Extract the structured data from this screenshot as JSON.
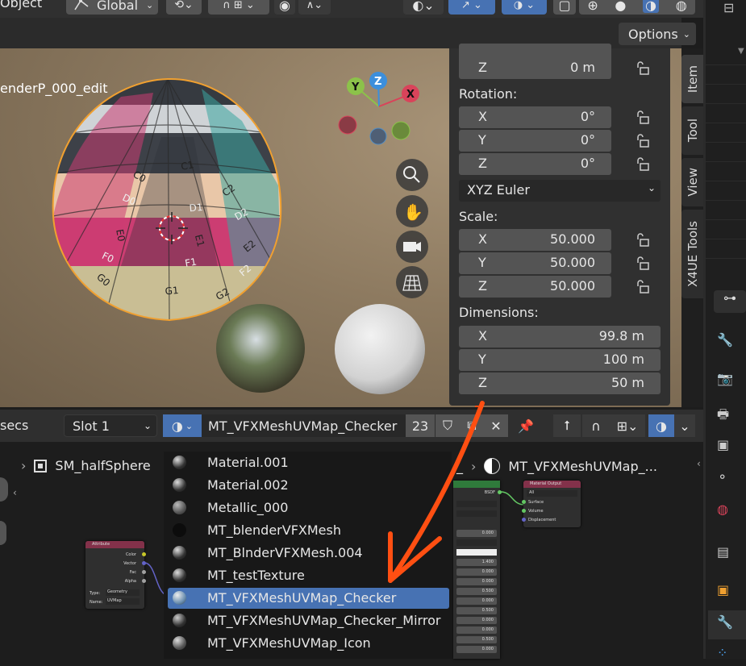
{
  "header": {
    "mode_label": "Object",
    "orientation_label": "Global",
    "options_label": "Options"
  },
  "viewport": {
    "object_name": "enderP_000_edit",
    "gizmo": {
      "x": "X",
      "y": "Y",
      "z": "Z"
    },
    "sphere_labels": [
      "C0",
      "C1",
      "C2",
      "D0",
      "D1",
      "D2",
      "E0",
      "E1",
      "E2",
      "F0",
      "F1",
      "F2",
      "G0",
      "G1",
      "G2"
    ]
  },
  "item_panel": {
    "location_z_label": "Z",
    "location_z_value": "0 m",
    "rotation_label": "Rotation:",
    "rotation": [
      {
        "axis": "X",
        "value": "0°"
      },
      {
        "axis": "Y",
        "value": "0°"
      },
      {
        "axis": "Z",
        "value": "0°"
      }
    ],
    "rotation_mode": "XYZ Euler",
    "scale_label": "Scale:",
    "scale": [
      {
        "axis": "X",
        "value": "50.000"
      },
      {
        "axis": "Y",
        "value": "50.000"
      },
      {
        "axis": "Z",
        "value": "50.000"
      }
    ],
    "dimensions_label": "Dimensions:",
    "dimensions": [
      {
        "axis": "X",
        "value": "99.8 m"
      },
      {
        "axis": "Y",
        "value": "100 m"
      },
      {
        "axis": "Z",
        "value": "50 m"
      }
    ]
  },
  "sidebar_tabs": [
    "Item",
    "Tool",
    "View",
    "X4UE Tools"
  ],
  "node_header": {
    "left_cut_label": "secs",
    "slot_label": "Slot 1",
    "material_name": "MT_VFXMeshUVMap_Checker",
    "user_count": "23"
  },
  "breadcrumb": {
    "object": "SM_halfSphere",
    "cut": "_",
    "material": "MT_VFXMeshUVMap_..."
  },
  "material_list": [
    {
      "name": "Material.001",
      "selected": false
    },
    {
      "name": "Material.002",
      "selected": false
    },
    {
      "name": "Metallic_000",
      "selected": false
    },
    {
      "name": "MT_blenderVFXMesh",
      "selected": false
    },
    {
      "name": "MT_BlnderVFXMesh.004",
      "selected": false
    },
    {
      "name": "MT_testTexture",
      "selected": false
    },
    {
      "name": "MT_VFXMeshUVMap_Checker",
      "selected": true
    },
    {
      "name": "MT_VFXMeshUVMap_Checker_Mirror",
      "selected": false
    },
    {
      "name": "MT_VFXMeshUVMap_Icon",
      "selected": false
    }
  ],
  "attribute_node": {
    "title": "Attribute",
    "outputs": [
      "Color",
      "Vector",
      "Fac",
      "Alpha"
    ],
    "type_label": "Type:",
    "type_value": "Geometry",
    "name_label": "Name:",
    "name_value": "UVMap"
  },
  "output_node": {
    "title": "Material Output",
    "target": "All",
    "inputs": [
      "Surface",
      "Volume",
      "Displacement"
    ]
  },
  "bsdf_node": {
    "output_label": "BSDF",
    "values": [
      "0.000",
      "1.400",
      "0.000",
      "0.000",
      "0.500",
      "0.000",
      "0.500",
      "0.000",
      "0.000",
      "0.500",
      "0.000",
      "0.500"
    ]
  },
  "colors": {
    "accent_selected": "#4772b3",
    "annotation_arrow": "#ff4f12",
    "selection_outline": "#f0a030"
  }
}
